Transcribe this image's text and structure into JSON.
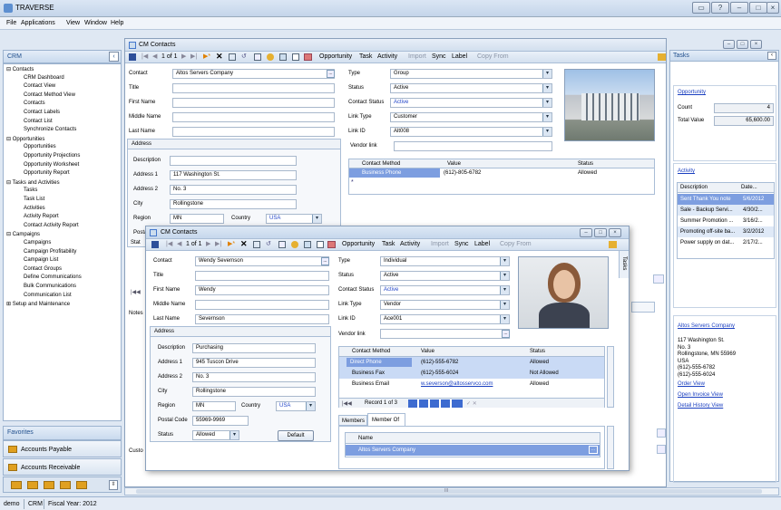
{
  "app": {
    "title": "TRAVERSE"
  },
  "menu": {
    "file": "File",
    "applications": "Applications",
    "view": "View",
    "window": "Window",
    "help": "Help"
  },
  "crm": {
    "header": "CRM"
  },
  "tree": [
    "⊟ Contacts",
    "CRM Dashboard",
    "Contact View",
    "Contact Method View",
    "Contacts",
    "Contact Labels",
    "Contact List",
    "Synchronize Contacts",
    "⊟ Opportunities",
    "Opportunities",
    "Opportunity Projections",
    "Opportunity Worksheet",
    "Opportunity Report",
    "⊟ Tasks and Activities",
    "Tasks",
    "Task List",
    "Activities",
    "Activity Report",
    "Contact Activity Report",
    "⊟ Campaigns",
    "Campaigns",
    "Campaign Profitability",
    "Campaign List",
    "Contact Groups",
    "Define Communications",
    "Bulk Communications",
    "Communication List",
    "⊞ Setup and Maintenance"
  ],
  "favorites": {
    "header": "Favorites",
    "items": [
      "Accounts Payable",
      "Accounts Receivable"
    ]
  },
  "cm": {
    "title": "CM Contacts",
    "toolbar": {
      "record": "1 of 1",
      "opportunity": "Opportunity",
      "task": "Task",
      "activity": "Activity",
      "import": "Import",
      "sync": "Sync",
      "label": "Label",
      "copy": "Copy From"
    },
    "labels": {
      "contact": "Contact",
      "title": "Title",
      "first": "First Name",
      "middle": "Middle Name",
      "last": "Last Name",
      "address": "Address",
      "description": "Description",
      "addr1": "Address 1",
      "addr2": "Address 2",
      "city": "City",
      "region": "Region",
      "country": "Country",
      "postal": "Postal",
      "status": "Stat",
      "type": "Type",
      "cstatus": "Status",
      "contact_status": "Contact Status",
      "link_type": "Link Type",
      "link_id": "Link ID",
      "vendor_link": "Vendor link",
      "notes": "Notes",
      "custo": "Custo"
    },
    "values": {
      "contact": "Altos Servers Company",
      "addr1": "117 Washington St.",
      "addr2": "No. 3",
      "city": "Rollingstone",
      "region": "MN",
      "country": "USA",
      "type": "Group",
      "status": "Active",
      "contact_status": "Active",
      "link_type": "Customer",
      "link_id": "Alt008"
    },
    "methods": {
      "headers": [
        "Contact Method",
        "Value",
        "Status"
      ],
      "rows": [
        [
          "Business Phone",
          "(612)-805-6782",
          "Allowed"
        ]
      ]
    }
  },
  "cm2": {
    "title": "CM Contacts",
    "values": {
      "contact": "Wendy Severnson",
      "first": "Wendy",
      "last": "Severnson",
      "description": "Purchasing",
      "addr1": "945 Tuscon Drive",
      "addr2": "No. 3",
      "city": "Rollingstone",
      "region": "MN",
      "country": "USA",
      "postal": "55969-9969",
      "status": "Allowed",
      "type": "Individual",
      "cstatus": "Active",
      "contact_status": "Active",
      "link_type": "Vendor",
      "link_id": "Ace001"
    },
    "labels": {
      "postal": "Postal Code",
      "status": "Status",
      "default": "Default",
      "tasks_tab": "Tasks"
    },
    "methods": {
      "headers": [
        "Contact Method",
        "Value",
        "Status"
      ],
      "rows": [
        [
          "Direct Phone",
          "(612)-555-6782",
          "Allowed"
        ],
        [
          "Business Fax",
          "(612)-555-6024",
          "Not Allowed"
        ],
        [
          "Business Email",
          "w.severson@altosservco.com",
          "Allowed"
        ]
      ]
    },
    "record_nav": "Record 1 of 3",
    "tabs": [
      "Members",
      "Member Of"
    ],
    "member_of": {
      "header": "Name",
      "rows": [
        "Altos Servers Company"
      ]
    }
  },
  "tasks": {
    "header": "Tasks",
    "opportunity": {
      "title": "Opportunity",
      "count_label": "Count",
      "count": "4",
      "total_label": "Total Value",
      "total": "65,600.00"
    },
    "activity": {
      "title": "Activity",
      "headers": [
        "Description",
        "Date..."
      ],
      "rows": [
        [
          "Sent Thank You note",
          "5/6/2012"
        ],
        [
          "Sale - Backup Servi...",
          "4/30/2..."
        ],
        [
          "Summer Promotion ...",
          "3/16/2..."
        ],
        [
          "Promoting off-site ba...",
          "3/2/2012"
        ],
        [
          "Power supply on dat...",
          "2/17/2..."
        ]
      ]
    },
    "company": {
      "name": "Altos Servers Company",
      "lines": [
        "117 Washington St.",
        "No. 3",
        "Rollingstone, MN 55969",
        "USA",
        "(612)-555-6782",
        "(612)-555-6024"
      ]
    },
    "links": [
      "Order View",
      "Open Invoice View",
      "Detail History View"
    ]
  },
  "status": {
    "user": "demo",
    "module": "CRM",
    "fiscal": "Fiscal Year: 2012"
  },
  "scroll": {
    "grip": "III"
  }
}
